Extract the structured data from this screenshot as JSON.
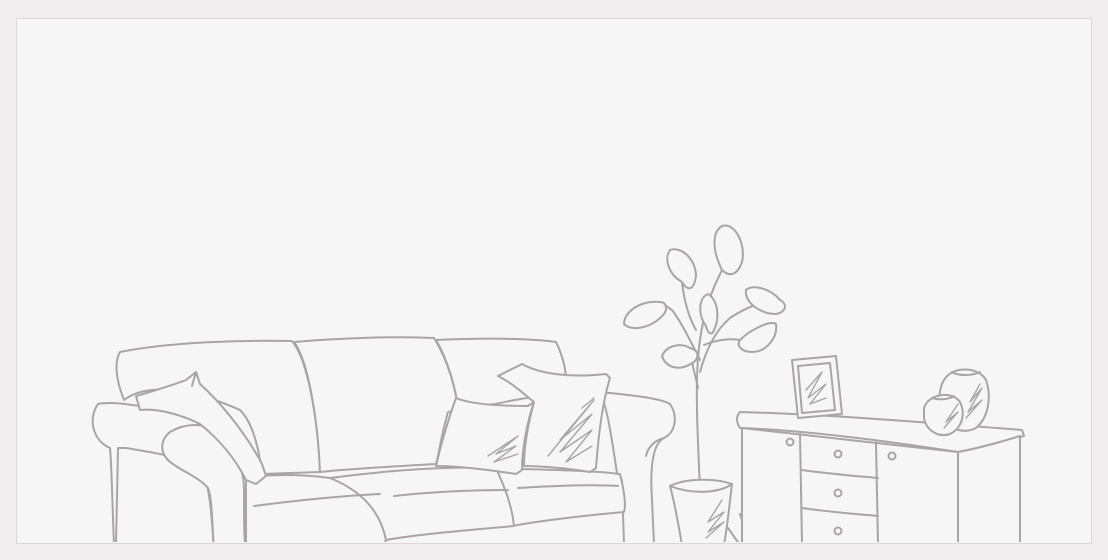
{
  "illustration": {
    "subject": "line-art-living-room",
    "stroke_color": "#a9a4a5",
    "fill_color": "#f7f6f6",
    "background_color": "#f7f6f6",
    "page_background": "#efeded",
    "frame_border_color": "#dcd8d8",
    "objects": [
      "sofa",
      "cushion-left",
      "cushion-middle",
      "cushion-right",
      "potted-plant",
      "sideboard",
      "picture-frame",
      "vase-large",
      "vase-small"
    ]
  }
}
